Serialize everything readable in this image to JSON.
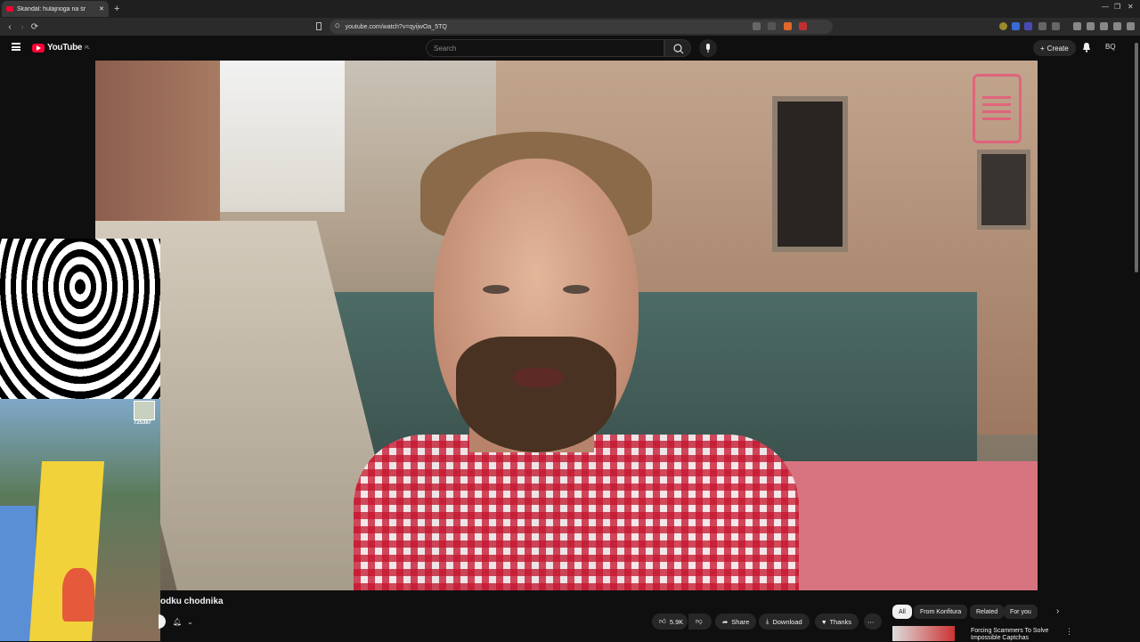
{
  "browser": {
    "tab_title": "Skandal: hulajnoga na śr",
    "tab_close": "✕",
    "new_tab": "+",
    "url": "youtube.com/watch?v=qyijwOa_5TQ",
    "back": "‹",
    "forward": "›",
    "reload": "⟳"
  },
  "youtube": {
    "logo_text": "YouTube",
    "region": "PL",
    "search_placeholder": "Search",
    "create_label": "Create",
    "avatar_initials": "BQ"
  },
  "video": {
    "title_fragment": "odku chodnika",
    "overlay_score": "725387"
  },
  "actions": {
    "like_count": "5.9K",
    "share": "Share",
    "download": "Download",
    "thanks": "Thanks",
    "more": "⋯"
  },
  "chips": [
    "All",
    "From Konfitura",
    "Related",
    "For you"
  ],
  "recommendation": {
    "title": "Forcing Scammers To Solve Impossible Captchas"
  },
  "colors": {
    "youtube_red": "#ff0033",
    "background": "#0f0f0f",
    "watermark": "#e65a7a"
  }
}
